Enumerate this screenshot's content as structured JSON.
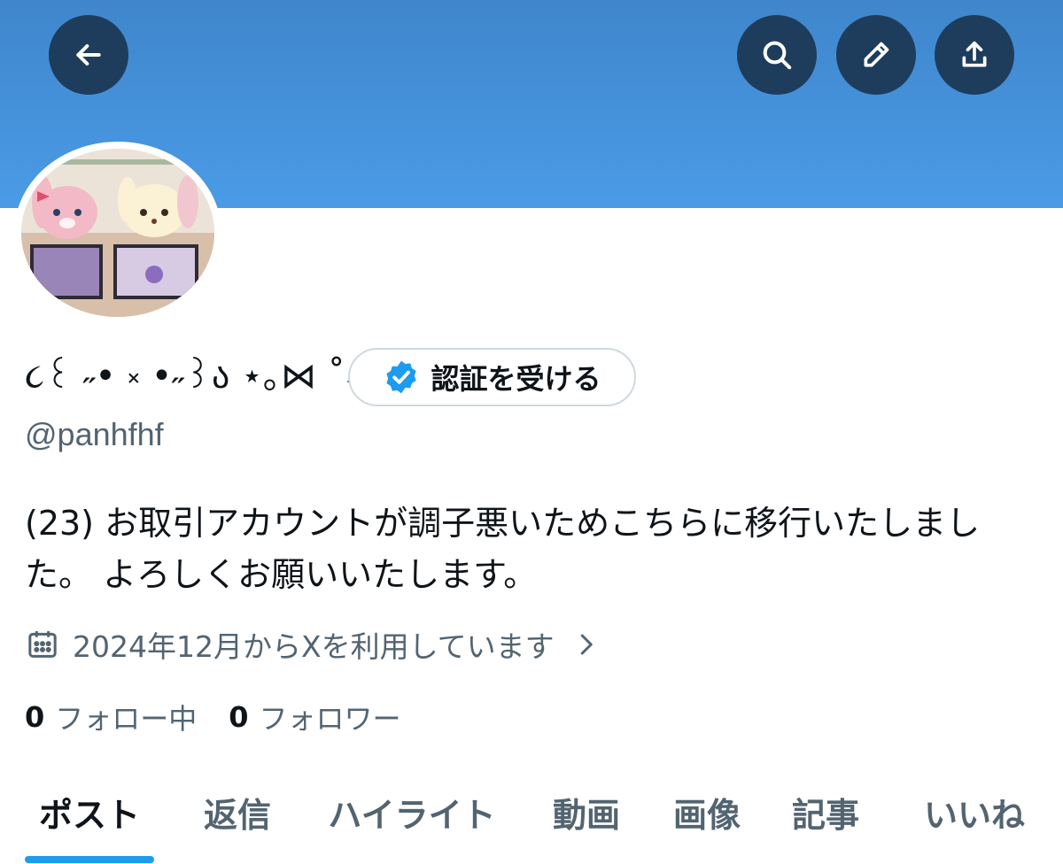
{
  "header": {
    "back_icon": "arrow-left-icon",
    "search_icon": "search-icon",
    "edit_icon": "pencil-icon",
    "share_icon": "share-icon",
    "banner_color": "#4a9be6",
    "button_color": "#1e3d5c"
  },
  "profile": {
    "display_name": "૮꒰ ˶• ༝ •˶꒱ა ⋆｡⋈ ˚₊",
    "verify_button_label": "認証を受ける",
    "verify_icon": "verified-badge-icon",
    "handle": "@panhfhf",
    "bio": "(23) お取引アカウントが調子悪いためこちらに移行いたしました。 よろしくお願いいたします。",
    "joined": "2024年12月からXを利用しています",
    "following_count": "0",
    "following_label": "フォロー中",
    "followers_count": "0",
    "followers_label": "フォロワー"
  },
  "tabs": [
    {
      "label": "ポスト",
      "active": true
    },
    {
      "label": "返信",
      "active": false
    },
    {
      "label": "ハイライト",
      "active": false
    },
    {
      "label": "動画",
      "active": false
    },
    {
      "label": "画像",
      "active": false
    },
    {
      "label": "記事",
      "active": false
    },
    {
      "label": "いいね",
      "active": false
    }
  ],
  "colors": {
    "accent": "#1d9bf0",
    "secondary_text": "#536471",
    "primary_text": "#0f1419"
  }
}
